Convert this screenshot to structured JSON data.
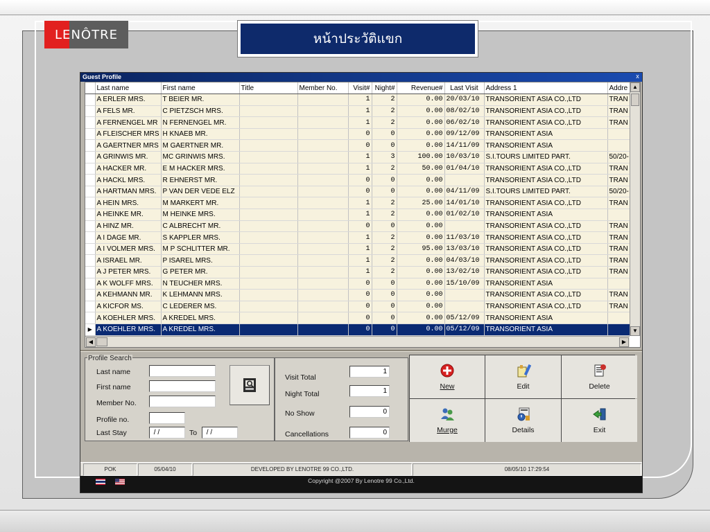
{
  "slide": {
    "logo_part1": "LE",
    "logo_part2": "NÔTRE",
    "title": "หน้าประวัติแขก"
  },
  "window": {
    "title": "Guest Profile",
    "close_glyph": "x"
  },
  "grid": {
    "columns": [
      "Last name",
      "First name",
      "Title",
      "Member No.",
      "Visit#",
      "Night#",
      "Revenue#",
      "Last Visit",
      "Address 1",
      "Addre"
    ],
    "rows": [
      [
        "A ERLER MRS.",
        "T BEIER MR.",
        "",
        "",
        "1",
        "2",
        "0.00",
        "20/03/10",
        "TRANSORIENT ASIA CO.,LTD",
        "TRAN"
      ],
      [
        "A FELS MR.",
        "C PIETZSCH MRS.",
        "",
        "",
        "1",
        "2",
        "0.00",
        "08/02/10",
        "TRANSORIENT ASIA CO.,LTD",
        "TRAN"
      ],
      [
        "A FERNENGEL MR",
        "N FERNENGEL MR.",
        "",
        "",
        "1",
        "2",
        "0.00",
        "06/02/10",
        "TRANSORIENT ASIA CO.,LTD",
        "TRAN"
      ],
      [
        "A FLEISCHER MRS",
        "H KNAEB MR.",
        "",
        "",
        "0",
        "0",
        "0.00",
        "09/12/09",
        "TRANSORIENT ASIA",
        ""
      ],
      [
        "A GAERTNER MRS",
        "M GAERTNER MR.",
        "",
        "",
        "0",
        "0",
        "0.00",
        "14/11/09",
        "TRANSORIENT ASIA",
        ""
      ],
      [
        "A GRINWIS MR.",
        "MC GRINWIS MRS.",
        "",
        "",
        "1",
        "3",
        "100.00",
        "10/03/10",
        "S.I.TOURS LIMITED PART.",
        "50/20-"
      ],
      [
        "A HACKER MR.",
        "E M HACKER MRS.",
        "",
        "",
        "1",
        "2",
        "50.00",
        "01/04/10",
        "TRANSORIENT ASIA CO.,LTD",
        "TRAN"
      ],
      [
        "A HACKL MRS.",
        "R EHNERST MR.",
        "",
        "",
        "0",
        "0",
        "0.00",
        "",
        "TRANSORIENT ASIA CO.,LTD",
        "TRAN"
      ],
      [
        "A HARTMAN MRS.",
        "P VAN DER VEDE ELZ",
        "",
        "",
        "0",
        "0",
        "0.00",
        "04/11/09",
        "S.I.TOURS LIMITED PART.",
        "50/20-"
      ],
      [
        "A HEIN MRS.",
        "M MARKERT MR.",
        "",
        "",
        "1",
        "2",
        "25.00",
        "14/01/10",
        "TRANSORIENT ASIA CO.,LTD",
        "TRAN"
      ],
      [
        "A HEINKE MR.",
        "M HEINKE MRS.",
        "",
        "",
        "1",
        "2",
        "0.00",
        "01/02/10",
        "TRANSORIENT ASIA",
        ""
      ],
      [
        "A HINZ MR.",
        "C ALBRECHT MR.",
        "",
        "",
        "0",
        "0",
        "0.00",
        "",
        "TRANSORIENT ASIA CO.,LTD",
        "TRAN"
      ],
      [
        "A I DAGE MR.",
        "S KAPPLER MRS.",
        "",
        "",
        "1",
        "2",
        "0.00",
        "11/03/10",
        "TRANSORIENT ASIA CO.,LTD",
        "TRAN"
      ],
      [
        "A I VOLMER MRS.",
        "M P SCHLITTER MR.",
        "",
        "",
        "1",
        "2",
        "95.00",
        "13/03/10",
        "TRANSORIENT ASIA CO.,LTD",
        "TRAN"
      ],
      [
        "A ISRAEL MR.",
        "P ISAREL MRS.",
        "",
        "",
        "1",
        "2",
        "0.00",
        "04/03/10",
        "TRANSORIENT ASIA CO.,LTD",
        "TRAN"
      ],
      [
        "A J PETER MRS.",
        "G PETER MR.",
        "",
        "",
        "1",
        "2",
        "0.00",
        "13/02/10",
        "TRANSORIENT ASIA CO.,LTD",
        "TRAN"
      ],
      [
        "A K WOLFF MRS.",
        "N TEUCHER MRS.",
        "",
        "",
        "0",
        "0",
        "0.00",
        "15/10/09",
        "TRANSORIENT ASIA",
        ""
      ],
      [
        "A KEHMANN MR.",
        "K LEHMANN MRS.",
        "",
        "",
        "0",
        "0",
        "0.00",
        "",
        "TRANSORIENT ASIA CO.,LTD",
        "TRAN"
      ],
      [
        "A KICFOR MS.",
        "C LEDERER MS.",
        "",
        "",
        "0",
        "0",
        "0.00",
        "",
        "TRANSORIENT ASIA CO.,LTD",
        "TRAN"
      ],
      [
        "A KOEHLER MRS.",
        "A KREDEL MRS.",
        "",
        "",
        "0",
        "0",
        "0.00",
        "05/12/09",
        "TRANSORIENT ASIA",
        ""
      ],
      [
        "A KOEHLER MRS.",
        "A KREDEL MRS.",
        "",
        "",
        "0",
        "0",
        "0.00",
        "05/12/09",
        "TRANSORIENT ASIA",
        ""
      ]
    ],
    "selected_index": 20,
    "current_marker": "▶"
  },
  "search": {
    "legend": "Profile Search",
    "last_name_label": "Last name",
    "first_name_label": "First name",
    "member_no_label": "Member No.",
    "profile_no_label": "Profile no.",
    "last_stay_label": "Last Stay",
    "to_label": "To",
    "last_name_value": "",
    "first_name_value": "",
    "member_no_value": "",
    "profile_no_value": "",
    "last_stay_from": " / /",
    "last_stay_to": " / /"
  },
  "totals": {
    "visit_label": "Visit Total",
    "visit_value": "1",
    "night_label": "Night Total",
    "night_value": "1",
    "noshow_label": "No Show",
    "noshow_value": "0",
    "cancel_label": "Cancellations",
    "cancel_value": "0"
  },
  "actions": {
    "new_label": "New",
    "edit_label": "Edit",
    "delete_label": "Delete",
    "merge_label": "Murge",
    "details_label": "Details",
    "exit_label": "Exit"
  },
  "status": {
    "user": "POK",
    "date": "05/04/10",
    "developer": "DEVELOPED BY LENOTRE 99 CO.,LTD.",
    "datetime": "08/05/10  17:29:54",
    "copyright": "Copyright @2007 By Lenotre 99 Co.,Ltd."
  },
  "colors": {
    "selection": "#0a2a73",
    "grid_row": "#f7f2de",
    "title_bar": "#0e2a6b",
    "logo_red": "#e2201f"
  },
  "icons": [
    "search-icon",
    "add-icon",
    "edit-icon",
    "delete-icon",
    "merge-icon",
    "details-icon",
    "exit-icon",
    "thai-flag-icon",
    "us-flag-icon"
  ]
}
